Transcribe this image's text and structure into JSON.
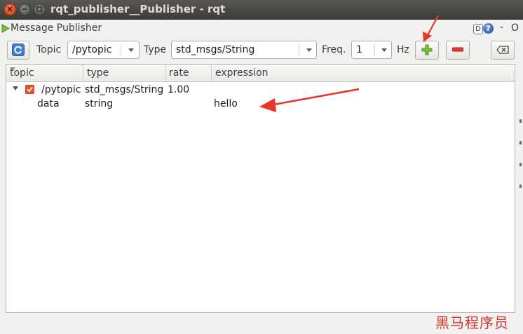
{
  "window": {
    "title": "rqt_publisher__Publisher - rqt"
  },
  "dock": {
    "title": "Message Publisher",
    "d_label": "D",
    "help_label": "?",
    "dash_label": "-",
    "o_label": "O"
  },
  "toolbar": {
    "topic_label": "Topic",
    "topic_value": "/pytopic",
    "type_label": "Type",
    "type_value": "std_msgs/String",
    "freq_label": "Freq.",
    "freq_value": "1",
    "hz_label": "Hz"
  },
  "table": {
    "columns": [
      "topic",
      "type",
      "rate",
      "expression"
    ],
    "rows": [
      {
        "topic": "/pytopic",
        "type": "std_msgs/String",
        "rate": "1.00",
        "expression": "",
        "checked": true,
        "expanded": true
      },
      {
        "topic": "data",
        "type": "string",
        "rate": "",
        "expression": "hello"
      }
    ]
  },
  "watermark": "黑马程序员",
  "colors": {
    "accent_add": "#6fb52c",
    "accent_remove": "#d9302a",
    "annotation_arrow": "#e8352b"
  }
}
